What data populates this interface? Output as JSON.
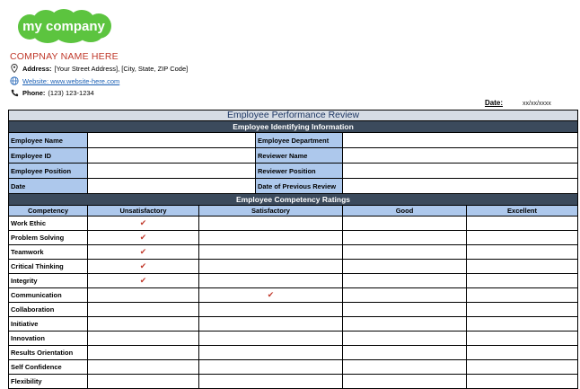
{
  "header": {
    "logo_text": "my company",
    "company_name": "COMPNAY NAME HERE",
    "address_label": "Address:",
    "address_value": "[Your Street Address], [City, State, ZIP Code]",
    "website": "Website: www.website-here.com",
    "phone_label": "Phone:",
    "phone_value": "(123) 123-1234",
    "date_label": "Date:",
    "date_value": "xx/xx/xxxx"
  },
  "form": {
    "title": "Employee Performance Review",
    "section1": "Employee Identifying Information",
    "info_rows": [
      {
        "left_label": "Employee Name",
        "left_value": "",
        "right_label": "Employee Department",
        "right_value": ""
      },
      {
        "left_label": "Employee ID",
        "left_value": "",
        "right_label": "Reviewer Name",
        "right_value": ""
      },
      {
        "left_label": "Employee Position",
        "left_value": "",
        "right_label": "Reviewer Position",
        "right_value": ""
      },
      {
        "left_label": "Date",
        "left_value": "",
        "right_label": "Date of Previous Review",
        "right_value": ""
      }
    ],
    "section2": "Employee Competency Ratings",
    "rating_headers": [
      "Competency",
      "Unsatisfactory",
      "Satisfactory",
      "Good",
      "Excellent"
    ],
    "check_mark": "✔",
    "competencies": [
      {
        "name": "Work Ethic",
        "rating": 1
      },
      {
        "name": "Problem Solving",
        "rating": 1
      },
      {
        "name": "Teamwork",
        "rating": 1
      },
      {
        "name": "Critical Thinking",
        "rating": 1
      },
      {
        "name": "Integrity",
        "rating": 1
      },
      {
        "name": "Communication",
        "rating": 2
      },
      {
        "name": "Collaboration",
        "rating": 0
      },
      {
        "name": "Initiative",
        "rating": 0
      },
      {
        "name": "Innovation",
        "rating": 0
      },
      {
        "name": "Results Orientation",
        "rating": 0
      },
      {
        "name": "Self Confidence",
        "rating": 0
      },
      {
        "name": "Flexibility",
        "rating": 0
      }
    ]
  },
  "colors": {
    "logo_green": "#5cc43f",
    "company_red": "#c0392b",
    "label_blue": "#adc8ec",
    "section_dark": "#3b4a5c",
    "title_gray": "#d6dce4"
  }
}
